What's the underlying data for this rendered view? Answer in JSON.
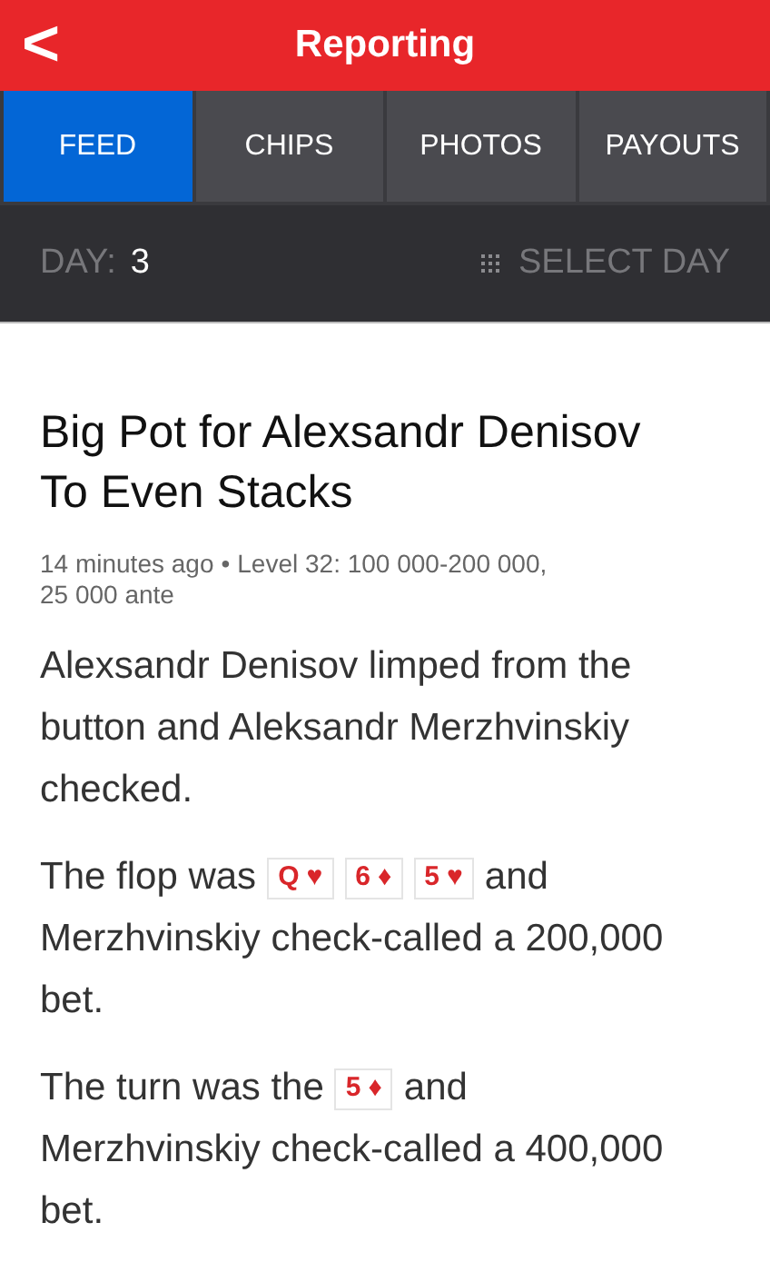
{
  "header": {
    "back": "<",
    "title": "Reporting"
  },
  "tabs": [
    {
      "label": "FEED",
      "selected": true
    },
    {
      "label": "CHIPS",
      "selected": false
    },
    {
      "label": "PHOTOS",
      "selected": false
    },
    {
      "label": "PAYOUTS",
      "selected": false
    }
  ],
  "day_bar": {
    "label": "DAY:",
    "value": "3",
    "select_label": "SELECT DAY"
  },
  "post": {
    "title_lines": [
      "Big Pot for Alexsandr Denisov",
      "To Even Stacks"
    ],
    "time": "14 minutes ago",
    "separator": "•",
    "level_lines": [
      "Level 32: 100 000-200 000,",
      "25 000 ante"
    ],
    "paragraphs": [
      [
        [
          {
            "kind": "text",
            "text": "Alexsandr Denisov limped from the"
          }
        ],
        [
          {
            "kind": "text",
            "text": "button and Aleksandr Merzhvinskiy"
          }
        ],
        [
          {
            "kind": "text",
            "text": "checked."
          }
        ]
      ],
      [
        [
          {
            "kind": "text",
            "text": "The flop was"
          },
          {
            "kind": "card",
            "rank": "Q",
            "suit": "♥"
          },
          {
            "kind": "card",
            "rank": "6",
            "suit": "♦"
          },
          {
            "kind": "card",
            "rank": "5",
            "suit": "♥"
          },
          {
            "kind": "text",
            "text": "and"
          }
        ],
        [
          {
            "kind": "text",
            "text": "Merzhvinskiy check-called a 200,000"
          }
        ],
        [
          {
            "kind": "text",
            "text": "bet."
          }
        ]
      ],
      [
        [
          {
            "kind": "text",
            "text": "The turn was the"
          },
          {
            "kind": "card",
            "rank": "5",
            "suit": "♦"
          },
          {
            "kind": "text",
            "text": "and"
          }
        ],
        [
          {
            "kind": "text",
            "text": "Merzhvinskiy check-called a 400,000"
          }
        ],
        [
          {
            "kind": "text",
            "text": "bet."
          }
        ]
      ]
    ]
  }
}
